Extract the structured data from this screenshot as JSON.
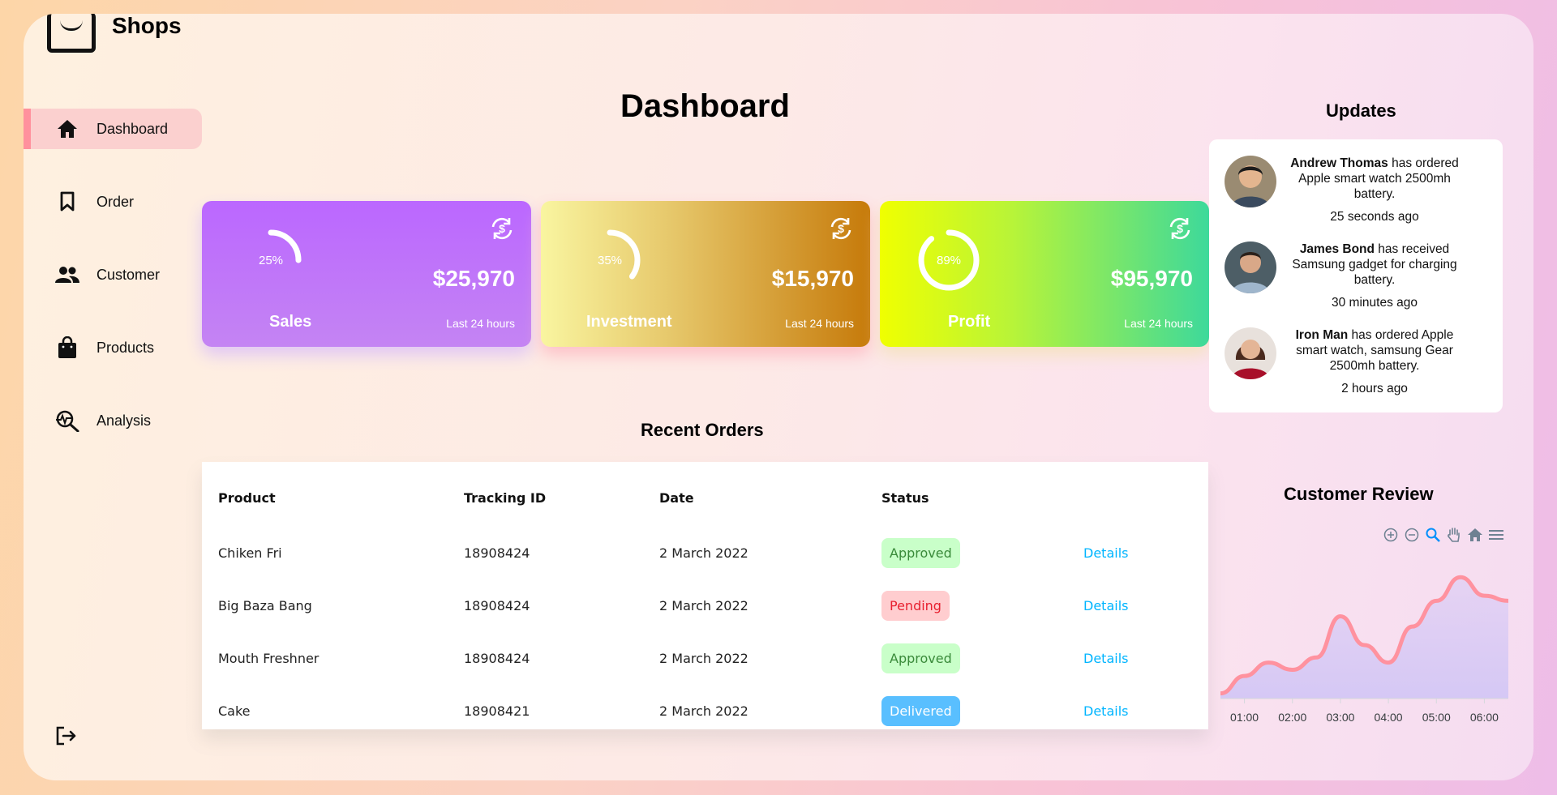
{
  "brand": {
    "name": "Shops"
  },
  "sidebar": {
    "items": [
      {
        "label": "Dashboard",
        "icon": "home-icon"
      },
      {
        "label": "Order",
        "icon": "bookmark-icon"
      },
      {
        "label": "Customer",
        "icon": "people-icon"
      },
      {
        "label": "Products",
        "icon": "shopping-bag-icon"
      },
      {
        "label": "Analysis",
        "icon": "analysis-icon"
      }
    ],
    "logout_icon": "logout-icon"
  },
  "page": {
    "title": "Dashboard"
  },
  "cards": [
    {
      "name": "Sales",
      "percent": 25,
      "percent_label": "25%",
      "value": "$25,970",
      "sub": "Last 24 hours"
    },
    {
      "name": "Investment",
      "percent": 35,
      "percent_label": "35%",
      "value": "$15,970",
      "sub": "Last 24 hours"
    },
    {
      "name": "Profit",
      "percent": 89,
      "percent_label": "89%",
      "value": "$95,970",
      "sub": "Last 24 hours"
    }
  ],
  "orders": {
    "title": "Recent Orders",
    "headers": [
      "Product",
      "Tracking ID",
      "Date",
      "Status"
    ],
    "rows": [
      {
        "product": "Chiken Fri",
        "tracking": "18908424",
        "date": "2 March 2022",
        "status": "Approved",
        "action": "Details"
      },
      {
        "product": "Big Baza Bang",
        "tracking": "18908424",
        "date": "2 March 2022",
        "status": "Pending",
        "action": "Details"
      },
      {
        "product": "Mouth Freshner",
        "tracking": "18908424",
        "date": "2 March 2022",
        "status": "Approved",
        "action": "Details"
      },
      {
        "product": "Cake",
        "tracking": "18908421",
        "date": "2 March 2022",
        "status": "Delivered",
        "action": "Details"
      }
    ]
  },
  "updates": {
    "title": "Updates",
    "items": [
      {
        "name": "Andrew Thomas",
        "text": "has ordered Apple smart watch 2500mh battery.",
        "time": "25 seconds ago"
      },
      {
        "name": "James Bond",
        "text": "has received Samsung gadget for charging battery.",
        "time": "30 minutes ago"
      },
      {
        "name": "Iron Man",
        "text": "has ordered Apple smart watch, samsung Gear 2500mh battery.",
        "time": "2 hours ago"
      }
    ]
  },
  "review": {
    "title": "Customer Review",
    "toolbar": [
      "zoom-in-icon",
      "zoom-out-icon",
      "magnify-icon",
      "pan-hand-icon",
      "home-icon",
      "menu-icon"
    ]
  },
  "chart_data": {
    "type": "area",
    "x": [
      "00:30",
      "01:00",
      "01:30",
      "02:00",
      "02:30",
      "03:00",
      "03:30",
      "04:00",
      "04:30",
      "05:00",
      "05:30",
      "06:00",
      "06:30"
    ],
    "tick_labels": [
      "01:00",
      "02:00",
      "03:00",
      "04:00",
      "05:00",
      "06:00"
    ],
    "series": [
      {
        "values": [
          5,
          22,
          35,
          28,
          40,
          80,
          52,
          35,
          70,
          95,
          118,
          100,
          95
        ]
      }
    ],
    "ylim": [
      0,
      130
    ],
    "color": "#ff929f",
    "fill_color": "#d5c8f5"
  },
  "colors": {
    "accent": "#ff919d",
    "link": "#00b5ff"
  }
}
